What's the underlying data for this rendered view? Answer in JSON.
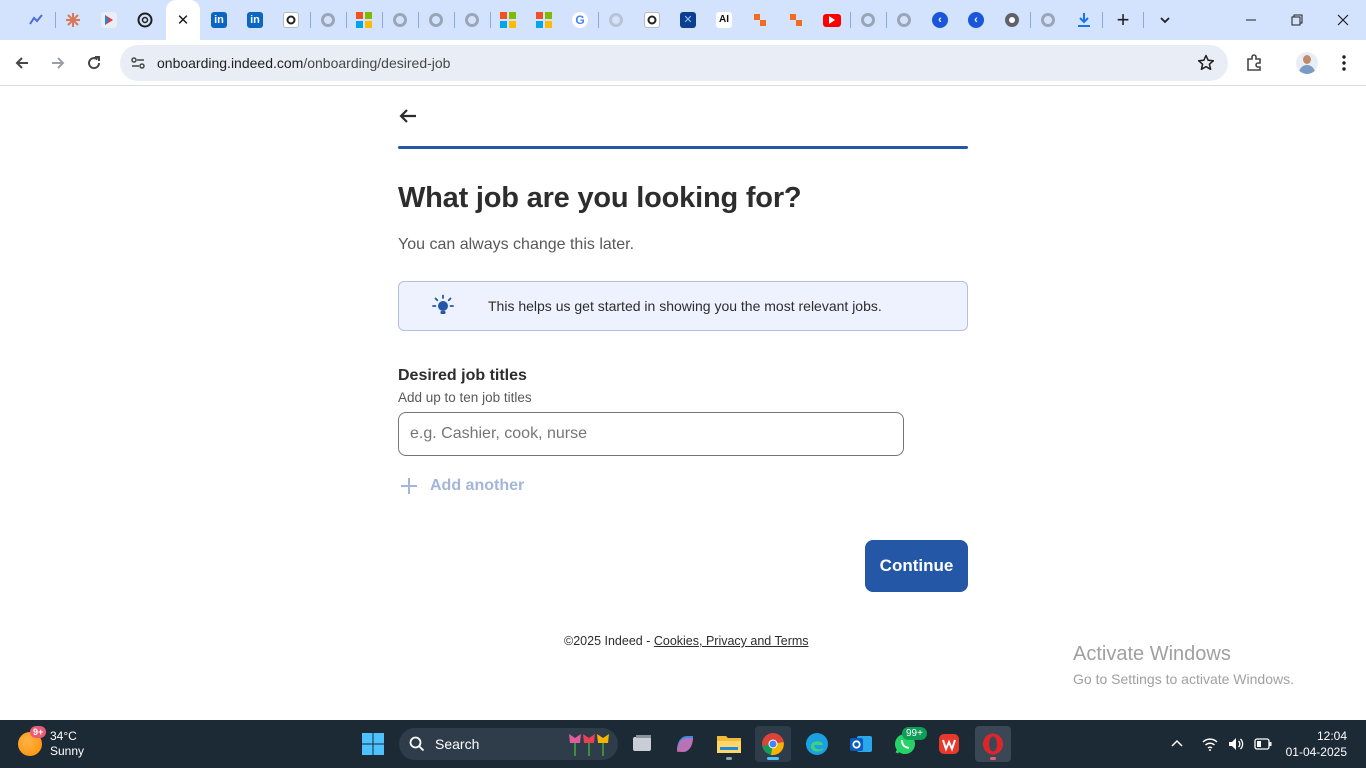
{
  "browser": {
    "active_tab_close": "✕",
    "new_tab": "+",
    "url_domain": "onboarding.indeed.com",
    "url_path": "/onboarding/desired-job"
  },
  "page": {
    "heading": "What job are you looking for?",
    "subheading": "You can always change this later.",
    "info_text": "This helps us get started in showing you the most relevant jobs.",
    "field_label": "Desired job titles",
    "field_help": "Add up to ten job titles",
    "input_placeholder": "e.g. Cashier, cook, nurse",
    "input_value": "",
    "add_another": "Add another",
    "continue": "Continue",
    "footer_copyright": "©2025 Indeed - ",
    "footer_link": "Cookies, Privacy and Terms",
    "progress": 1.0
  },
  "watermark": {
    "line1": "Activate Windows",
    "line2": "Go to Settings to activate Windows."
  },
  "taskbar": {
    "temperature": "34°C",
    "condition": "Sunny",
    "weather_badge": "9+",
    "search": "Search",
    "whatsapp_badge": "99+",
    "time": "12:04",
    "date": "01-04-2025"
  },
  "colors": {
    "indeed_blue": "#2557a7",
    "info_bg": "#eef1fe",
    "tabstrip": "#d3e3fd",
    "taskbar": "#1c2a36"
  }
}
